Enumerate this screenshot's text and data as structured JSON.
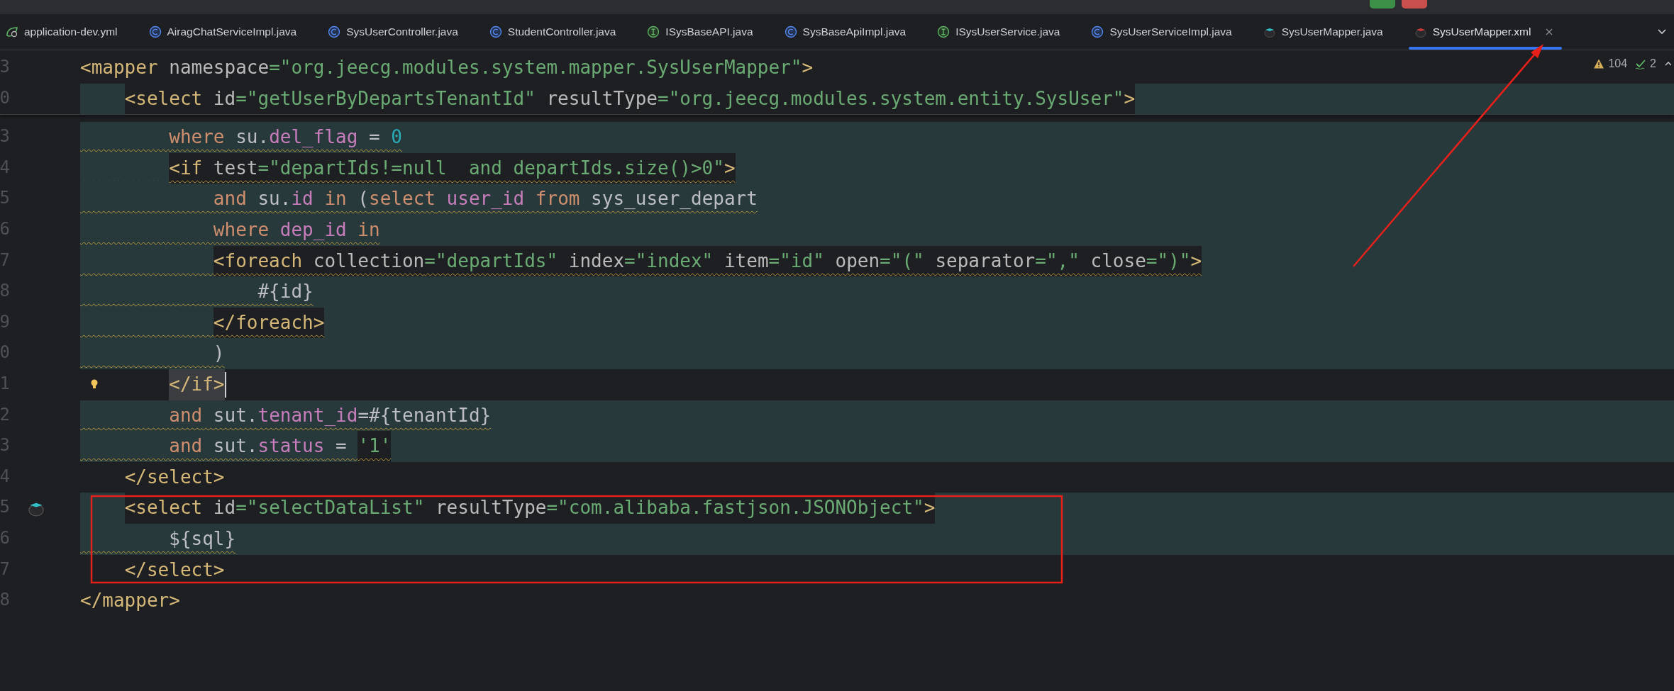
{
  "tabs": [
    {
      "label": "application-dev.yml",
      "kind": "yaml",
      "selected": false
    },
    {
      "label": "AiragChatServiceImpl.java",
      "kind": "class",
      "selected": false
    },
    {
      "label": "SysUserController.java",
      "kind": "class",
      "selected": false
    },
    {
      "label": "StudentController.java",
      "kind": "class",
      "selected": false
    },
    {
      "label": "ISysBaseAPI.java",
      "kind": "interface",
      "selected": false
    },
    {
      "label": "SysBaseApiImpl.java",
      "kind": "class",
      "selected": false
    },
    {
      "label": "ISysUserService.java",
      "kind": "interface",
      "selected": false
    },
    {
      "label": "SysUserServiceImpl.java",
      "kind": "class",
      "selected": false
    },
    {
      "label": "SysUserMapper.java",
      "kind": "mapper-java",
      "selected": false
    },
    {
      "label": "SysUserMapper.xml",
      "kind": "mapper-xml",
      "selected": true
    }
  ],
  "inspections": {
    "warnings": "104",
    "typos": "2"
  },
  "sticky_lines": [
    {
      "number": "3",
      "kind": "plain",
      "warning": false,
      "tokens": [
        {
          "kind": "tag",
          "s": "<mapper"
        },
        {
          "kind": "attr",
          "s": " namespace"
        },
        {
          "kind": "value",
          "s": "=\"org.jeecg.modules.system.mapper.SysUserMapper\""
        },
        {
          "kind": "tag",
          "s": ">"
        }
      ]
    },
    {
      "number": "0",
      "kind": "sql",
      "warning": false,
      "tokens": [
        {
          "kind": "tag",
          "s": "    <select"
        },
        {
          "kind": "attr",
          "s": " id"
        },
        {
          "kind": "value",
          "s": "=\"getUserByDepartsTenantId\""
        },
        {
          "kind": "attr",
          "s": " resultType"
        },
        {
          "kind": "value",
          "s": "=\"org.jeecg.modules.system.entity.SysUser\""
        },
        {
          "kind": "tag",
          "s": ">"
        }
      ]
    }
  ],
  "lines": [
    {
      "number": "3",
      "kind": "sql",
      "warning": true,
      "tokens": [
        {
          "kind": "kw",
          "s": "        where"
        },
        {
          "kind": "plain",
          "s": " su."
        },
        {
          "kind": "col",
          "s": "del_flag"
        },
        {
          "kind": "plain",
          "s": " = "
        },
        {
          "kind": "num",
          "s": "0"
        }
      ]
    },
    {
      "number": "4",
      "kind": "sql",
      "warning": true,
      "tokens": [
        {
          "kind": "match",
          "s": "        <if"
        },
        {
          "kind": "attr",
          "s": " test"
        },
        {
          "kind": "value",
          "s": "=\"departIds!=null  and departIds.size()>0\""
        },
        {
          "kind": "tag",
          "s": ">"
        }
      ]
    },
    {
      "number": "5",
      "kind": "sql",
      "warning": true,
      "tokens": [
        {
          "kind": "kw",
          "s": "            and"
        },
        {
          "kind": "plain",
          "s": " su."
        },
        {
          "kind": "col",
          "s": "id"
        },
        {
          "kind": "kw",
          "s": " in"
        },
        {
          "kind": "plain",
          "s": " ("
        },
        {
          "kind": "kw",
          "s": "select"
        },
        {
          "kind": "col",
          "s": " user_id"
        },
        {
          "kind": "kw",
          "s": " from"
        },
        {
          "kind": "plain",
          "s": " sys_user_depart"
        }
      ]
    },
    {
      "number": "6",
      "kind": "sql",
      "warning": true,
      "tokens": [
        {
          "kind": "kw",
          "s": "            where"
        },
        {
          "kind": "col",
          "s": " dep_id"
        },
        {
          "kind": "kw",
          "s": " in"
        }
      ]
    },
    {
      "number": "7",
      "kind": "sql",
      "warning": true,
      "tokens": [
        {
          "kind": "tag",
          "s": "            <foreach"
        },
        {
          "kind": "attr",
          "s": " collection"
        },
        {
          "kind": "value",
          "s": "=\"departIds\""
        },
        {
          "kind": "attr",
          "s": " index"
        },
        {
          "kind": "value",
          "s": "=\"index\""
        },
        {
          "kind": "attr",
          "s": " item"
        },
        {
          "kind": "value",
          "s": "=\"id\""
        },
        {
          "kind": "attr",
          "s": " open"
        },
        {
          "kind": "value",
          "s": "=\"(\""
        },
        {
          "kind": "attr",
          "s": " separator"
        },
        {
          "kind": "value",
          "s": "=\",\""
        },
        {
          "kind": "attr",
          "s": " close"
        },
        {
          "kind": "value",
          "s": "=\")\""
        },
        {
          "kind": "tag",
          "s": ">"
        }
      ]
    },
    {
      "number": "8",
      "kind": "sql",
      "warning": true,
      "tokens": [
        {
          "kind": "plain",
          "s": "                #{id}"
        }
      ]
    },
    {
      "number": "9",
      "kind": "sql",
      "warning": true,
      "tokens": [
        {
          "kind": "tag",
          "s": "            </foreach>"
        }
      ]
    },
    {
      "number": "0",
      "kind": "sql",
      "warning": true,
      "tokens": [
        {
          "kind": "plain",
          "s": "            )"
        }
      ]
    },
    {
      "number": "1",
      "kind": "current",
      "warning": false,
      "marker": {
        "kind": "bulb"
      },
      "tokens": [
        {
          "kind": "match",
          "s": "        </if>"
        }
      ]
    },
    {
      "number": "2",
      "kind": "sql",
      "warning": true,
      "tokens": [
        {
          "kind": "kw",
          "s": "        and"
        },
        {
          "kind": "plain",
          "s": " sut."
        },
        {
          "kind": "col",
          "s": "tenant_id"
        },
        {
          "kind": "plain",
          "s": "=#{tenantId}"
        }
      ]
    },
    {
      "number": "3",
      "kind": "sql",
      "warning": true,
      "tokens": [
        {
          "kind": "kw",
          "s": "        and"
        },
        {
          "kind": "plain",
          "s": " sut."
        },
        {
          "kind": "col",
          "s": "status"
        },
        {
          "kind": "plain",
          "s": " = "
        },
        {
          "kind": "value",
          "s": "'1'"
        }
      ]
    },
    {
      "number": "4",
      "kind": "plain",
      "warning": false,
      "tokens": [
        {
          "kind": "tag",
          "s": "    </select>"
        }
      ]
    },
    {
      "number": "5",
      "kind": "sql",
      "warning": false,
      "marker": {
        "kind": "mapper"
      },
      "tokens": [
        {
          "kind": "tag",
          "s": "    <select"
        },
        {
          "kind": "attr",
          "s": " id"
        },
        {
          "kind": "value",
          "s": "=\"selectDataList\""
        },
        {
          "kind": "attr",
          "s": " resultType"
        },
        {
          "kind": "value",
          "s": "=\"com.alibaba.fastjson.JSONObject\""
        },
        {
          "kind": "tag",
          "s": ">"
        }
      ]
    },
    {
      "number": "6",
      "kind": "sql",
      "warning": true,
      "tokens": [
        {
          "kind": "plain",
          "s": "        ${sql}"
        }
      ]
    },
    {
      "number": "7",
      "kind": "plain",
      "warning": false,
      "tokens": [
        {
          "kind": "tag",
          "s": "    </select>"
        }
      ]
    },
    {
      "number": "8",
      "kind": "plain",
      "warning": false,
      "tokens": [
        {
          "kind": "tag",
          "s": "</mapper>"
        }
      ]
    }
  ],
  "annotations": [
    {
      "kind": "arrow"
    },
    {
      "kind": "frame"
    }
  ]
}
